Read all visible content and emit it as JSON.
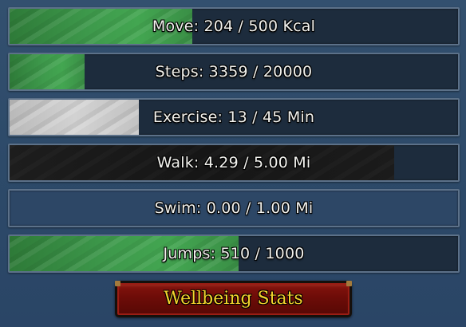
{
  "stats": [
    {
      "label": "Move: 204 / 500 Kcal",
      "progress": 0.408,
      "fill_color": "green"
    },
    {
      "label": "Steps: 3359 / 20000",
      "progress": 0.168,
      "fill_color": "green"
    },
    {
      "label": "Exercise: 13 / 45 Min",
      "progress": 0.289,
      "fill_color": "white"
    },
    {
      "label": "Walk: 4.29 / 5.00 Mi",
      "progress": 0.858,
      "fill_color": "black"
    },
    {
      "label": "Swim: 0.00 / 1.00 Mi",
      "progress": 0.0,
      "fill_color": "none"
    },
    {
      "label": "Jumps: 510 / 1000",
      "progress": 0.51,
      "fill_color": "green"
    }
  ],
  "title_button": {
    "label": "Wellbeing Stats",
    "background_color": "#6d0c08",
    "text_color": "#f3d22c"
  }
}
